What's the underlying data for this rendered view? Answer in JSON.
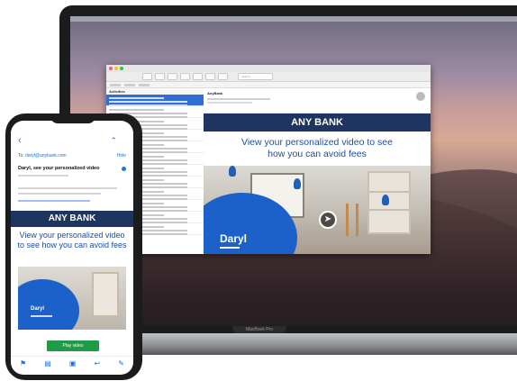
{
  "laptop": {
    "model_label": "MacBook Pro",
    "mail_window": {
      "list_heading": "Activities",
      "search_placeholder": "Search",
      "message_from": "AnyBank",
      "email": {
        "bank_name": "ANY BANK",
        "headline_line1": "View your personalized video to see",
        "headline_line2": "how you can avoid fees",
        "video_name": "Daryl"
      }
    }
  },
  "phone": {
    "to_label": "To:",
    "to_address": "daryl@anybank.com",
    "hide_label": "Hide",
    "subject": "Daryl, see your personalized video",
    "email": {
      "bank_name": "ANY BANK",
      "headline": "View your personalized video to see how you can avoid fees",
      "video_name": "Daryl",
      "play_button": "Play video"
    },
    "toolbar_icons": [
      "flag-icon",
      "folder-icon",
      "archive-icon",
      "reply-icon",
      "compose-icon"
    ]
  },
  "colors": {
    "bank_bar": "#1e3461",
    "headline": "#1a4fa8",
    "accent_blue": "#1b61c9",
    "play_button": "#1e9b45"
  }
}
